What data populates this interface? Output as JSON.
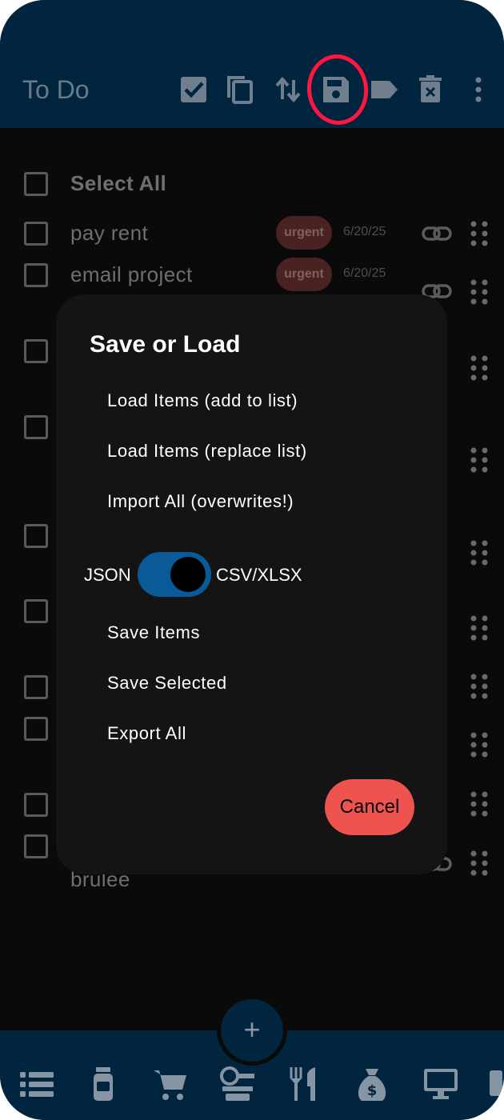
{
  "header": {
    "title": "To Do",
    "icons": [
      "select-all-icon",
      "copy-icon",
      "sort-icon",
      "save-icon",
      "label-icon",
      "delete-icon",
      "more-vert-icon"
    ]
  },
  "list": {
    "select_all_label": "Select All",
    "items": [
      {
        "text": "pay rent",
        "tag": "urgent",
        "date": "6/20/25"
      },
      {
        "text": "email project",
        "tag": "urgent",
        "date": "6/20/25"
      },
      {
        "text": "brulee"
      }
    ]
  },
  "dialog": {
    "title": "Save or Load",
    "load_add": "Load Items (add to list)",
    "load_replace": "Load Items (replace list)",
    "import_all": "Import All (overwrites!)",
    "format_left": "JSON",
    "format_right": "CSV/XLSX",
    "format_toggle_on": true,
    "save_items": "Save Items",
    "save_selected": "Save Selected",
    "export_all": "Export All",
    "cancel": "Cancel"
  },
  "fab": {
    "label": "+"
  },
  "bottom_nav": [
    "list-icon",
    "jar-icon",
    "cart-icon",
    "tools-icon",
    "restaurant-icon",
    "money-bag-icon",
    "monitor-icon"
  ],
  "colors": {
    "header_bg": "#01243f",
    "background": "#0a0a0a",
    "dialog_bg": "#141414",
    "toggle_on": "#0b5a98",
    "cancel_bg": "#ef5350",
    "highlight": "#ff1640",
    "tag_bg": "#4a2221"
  }
}
